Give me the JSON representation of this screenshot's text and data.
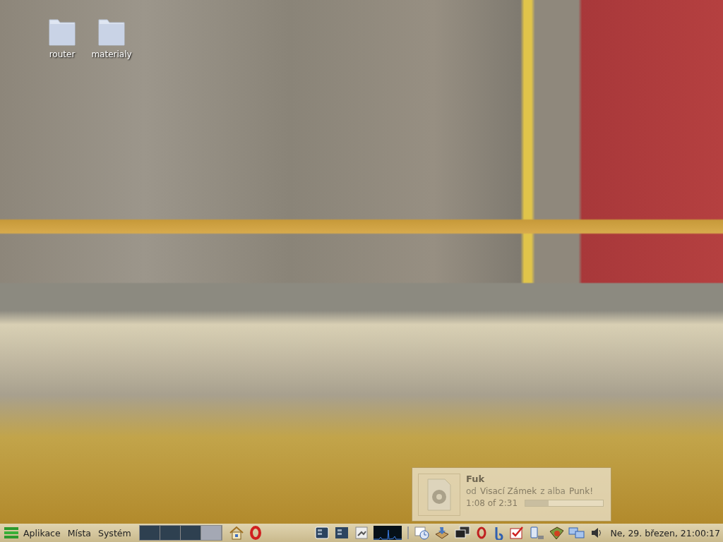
{
  "desktop": {
    "icons": [
      {
        "label": "router"
      },
      {
        "label": "materialy"
      }
    ]
  },
  "notification": {
    "title": "Fuk",
    "from_word": "od",
    "artist": "Visací Zámek",
    "album_word": "z alba",
    "album": "Punk!",
    "time": "1:08 of 2:31",
    "level": 0.3
  },
  "panel": {
    "menus": [
      "Aplikace",
      "Místa",
      "Systém"
    ],
    "workspaces": [
      {
        "selected": false
      },
      {
        "selected": false
      },
      {
        "selected": false
      },
      {
        "selected": true
      }
    ],
    "clock": "Ne, 29. březen, 21:00:17"
  }
}
